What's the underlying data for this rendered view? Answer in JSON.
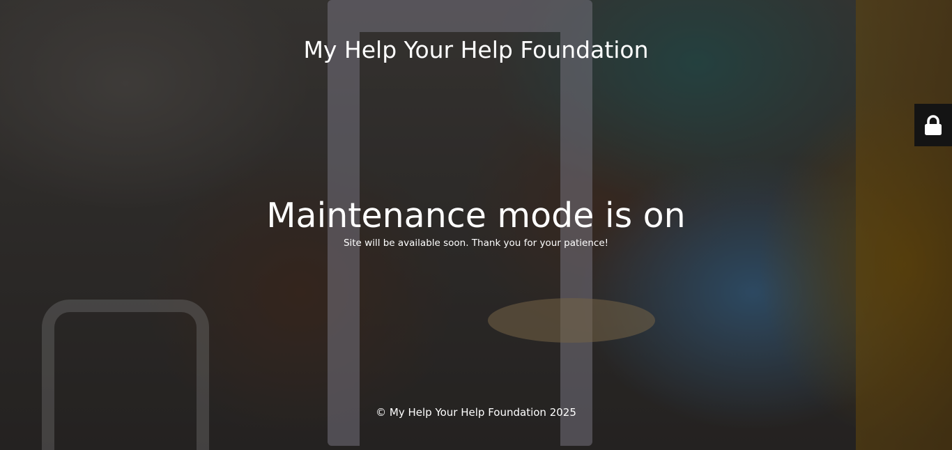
{
  "site": {
    "title": "My Help Your Help Foundation"
  },
  "maintenance": {
    "headline": "Maintenance mode is on",
    "message": "Site will be available soon. Thank you for your patience!"
  },
  "footer": {
    "copyright": "© My Help Your Help Foundation 2025"
  },
  "login": {
    "icon": "lock-icon"
  },
  "colors": {
    "text": "#ffffff",
    "login_button_bg": "#141414"
  }
}
